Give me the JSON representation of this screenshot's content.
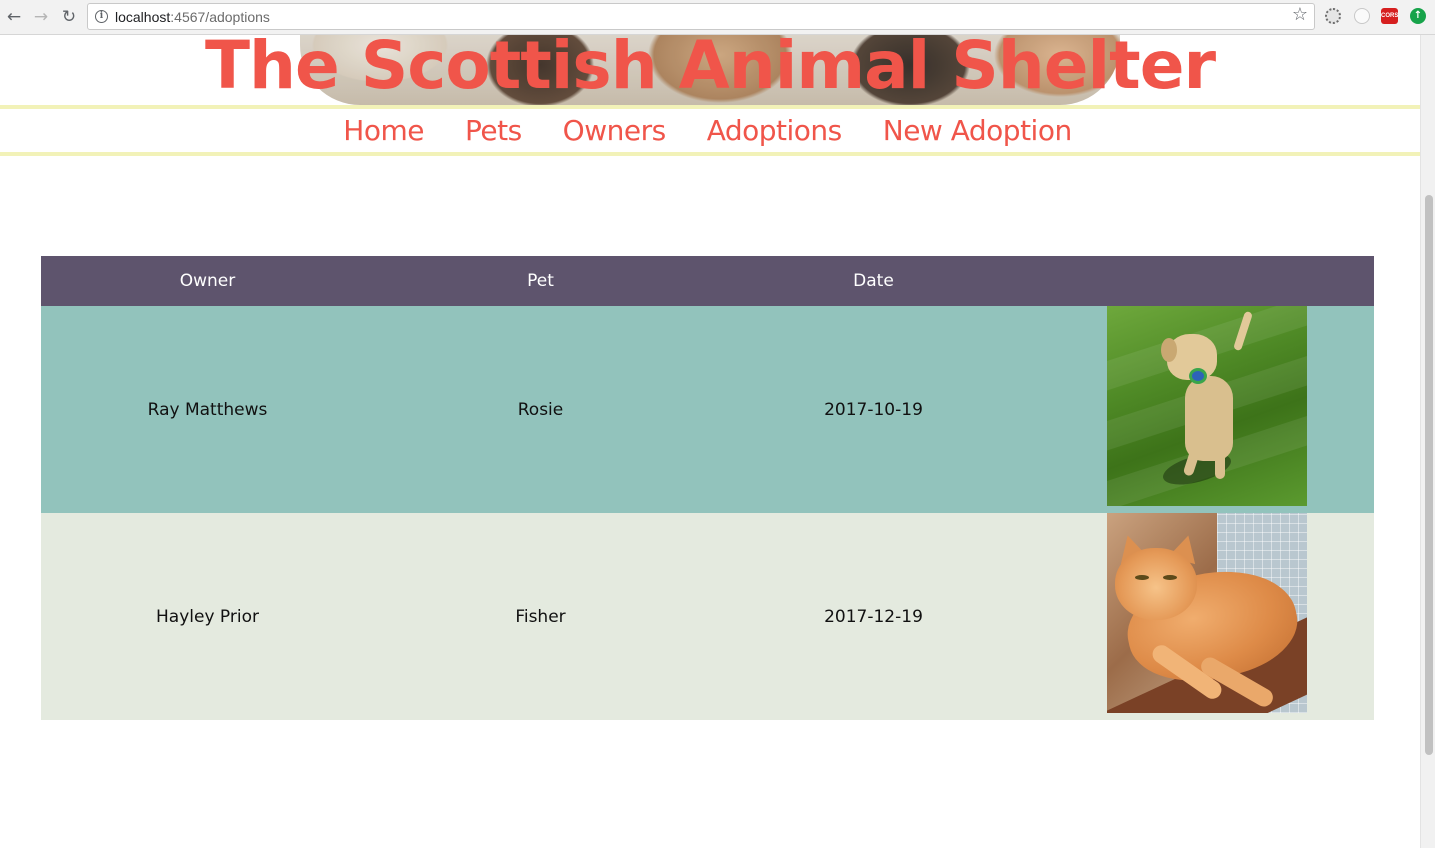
{
  "browser": {
    "url_host": "localhost",
    "url_rest": ":4567/adoptions"
  },
  "site": {
    "title": "The Scottish Animal Shelter"
  },
  "nav": {
    "items": [
      {
        "label": "Home"
      },
      {
        "label": "Pets"
      },
      {
        "label": "Owners"
      },
      {
        "label": "Adoptions"
      },
      {
        "label": "New Adoption"
      }
    ]
  },
  "adoptions": {
    "columns": [
      "Owner",
      "Pet",
      "Date",
      ""
    ],
    "rows": [
      {
        "owner": "Ray Matthews",
        "pet": "Rosie",
        "date": "2017-10-19",
        "photo": "dog-photo"
      },
      {
        "owner": "Hayley Prior",
        "pet": "Fisher",
        "date": "2017-12-19",
        "photo": "cat-photo"
      }
    ]
  },
  "colors": {
    "brand": "#f0554a",
    "nav_border": "#f2f2b8",
    "table_header": "#5e546d",
    "row_odd": "#92c3bc",
    "row_even": "#e4eadf"
  }
}
